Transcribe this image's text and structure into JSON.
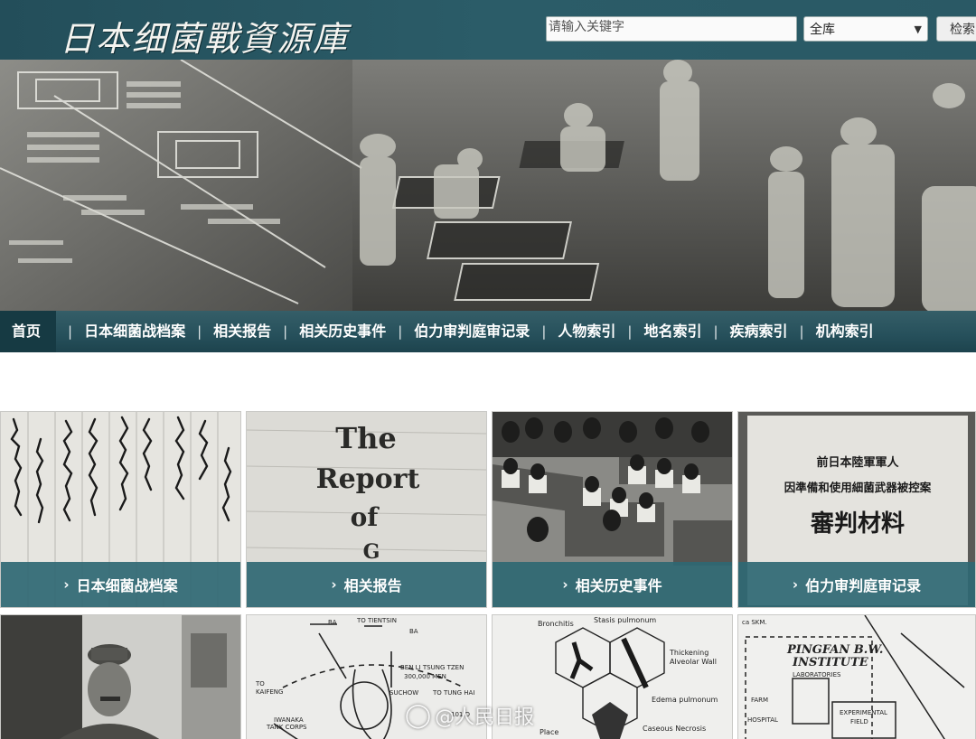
{
  "header": {
    "logo_text": "日本细菌戰資源庫",
    "search_placeholder": "请输入关键字",
    "scope_selected": "全库",
    "search_button": "检索"
  },
  "nav": {
    "items": [
      {
        "label": "首页",
        "active": true
      },
      {
        "label": "日本细菌战档案"
      },
      {
        "label": "相关报告"
      },
      {
        "label": "相关历史事件"
      },
      {
        "label": "伯力审判庭审记录"
      },
      {
        "label": "人物索引"
      },
      {
        "label": "地名索引"
      },
      {
        "label": "疾病索引"
      },
      {
        "label": "机构索引"
      }
    ],
    "separator": "|"
  },
  "tiles": [
    {
      "caption": "日本细菌战档案"
    },
    {
      "caption": "相关报告"
    },
    {
      "caption": "相关历史事件"
    },
    {
      "caption": "伯力审判庭审记录"
    }
  ],
  "tile_images": {
    "report": {
      "line1": "The",
      "line2": "Report",
      "line3": "of",
      "line4": "G"
    },
    "trial_doc": {
      "line1": "前日本陸軍軍人",
      "line2": "因準備和使用細菌武器被控案",
      "line3": "審判材料"
    },
    "map": {
      "ba_left": "BA",
      "tientsin": "TO TIENTSIN",
      "ba_right": "BA",
      "ben_li": "BEN LI TSUNG TZEN",
      "men": "300,000 MEN",
      "to": "TO",
      "kaifeng": "KAIFENG",
      "suchow": "SUCHOW",
      "tung_hai": "TO TUNG HAI",
      "iwanaka": "IWANAKA",
      "tank_corps": "TANK CORPS",
      "div": "101 D"
    },
    "pathology": {
      "bronchitis": "Bronchitis",
      "stasis": "Stasis pulmonum",
      "thickening": "Thickening",
      "alveolar": "Alveolar Wall",
      "edema": "Edema pulmonum",
      "caseous": "Caseous Necrosis",
      "place": "Place"
    },
    "pingfan": {
      "title1": "PINGFAN B.W.",
      "title2": "INSTITUTE",
      "labs": "LABORATORIES",
      "farm": "FARM",
      "hospital": "HOSPITAL",
      "experimental": "EXPERIMENTAL",
      "field": "FIELD",
      "sk": "ca SKM."
    }
  },
  "watermark": "@人民日报",
  "colors": {
    "header_bg": "#2b5c68",
    "nav_bg": "#26505b",
    "caption_bg": "#2f6873"
  }
}
